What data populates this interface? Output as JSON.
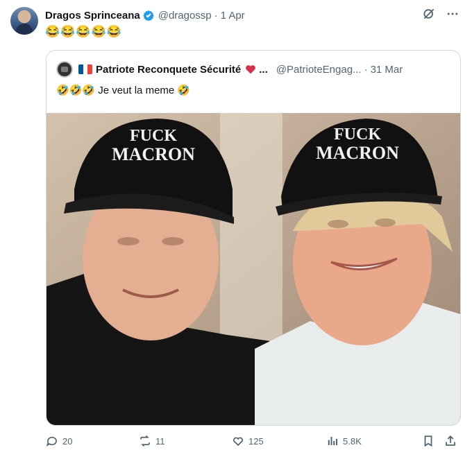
{
  "tweet": {
    "display_name": "Dragos Sprinceana",
    "handle": "@dragossp",
    "separator": "·",
    "date": "1 Apr",
    "text": "😂😂😂😂😂"
  },
  "quote": {
    "display_name": "Patriote Reconquete Sécurité",
    "ellipsis": "...",
    "handle": "@PatrioteEngag...",
    "separator": "·",
    "date": "31 Mar",
    "text": "🤣🤣🤣 Je veut la meme 🤣",
    "image": {
      "caps": [
        "FUCK",
        "MACRON"
      ]
    }
  },
  "actions": {
    "replies": "20",
    "reposts": "11",
    "likes": "125",
    "views": "5.8K"
  },
  "icons": [
    "verified-badge-icon",
    "grok-icon",
    "more-icon",
    "reply-icon",
    "repost-icon",
    "like-icon",
    "views-icon",
    "bookmark-icon",
    "share-icon"
  ],
  "colors": {
    "verified": "#1d9bf0",
    "muted": "#536471",
    "border": "#cfd9de"
  }
}
